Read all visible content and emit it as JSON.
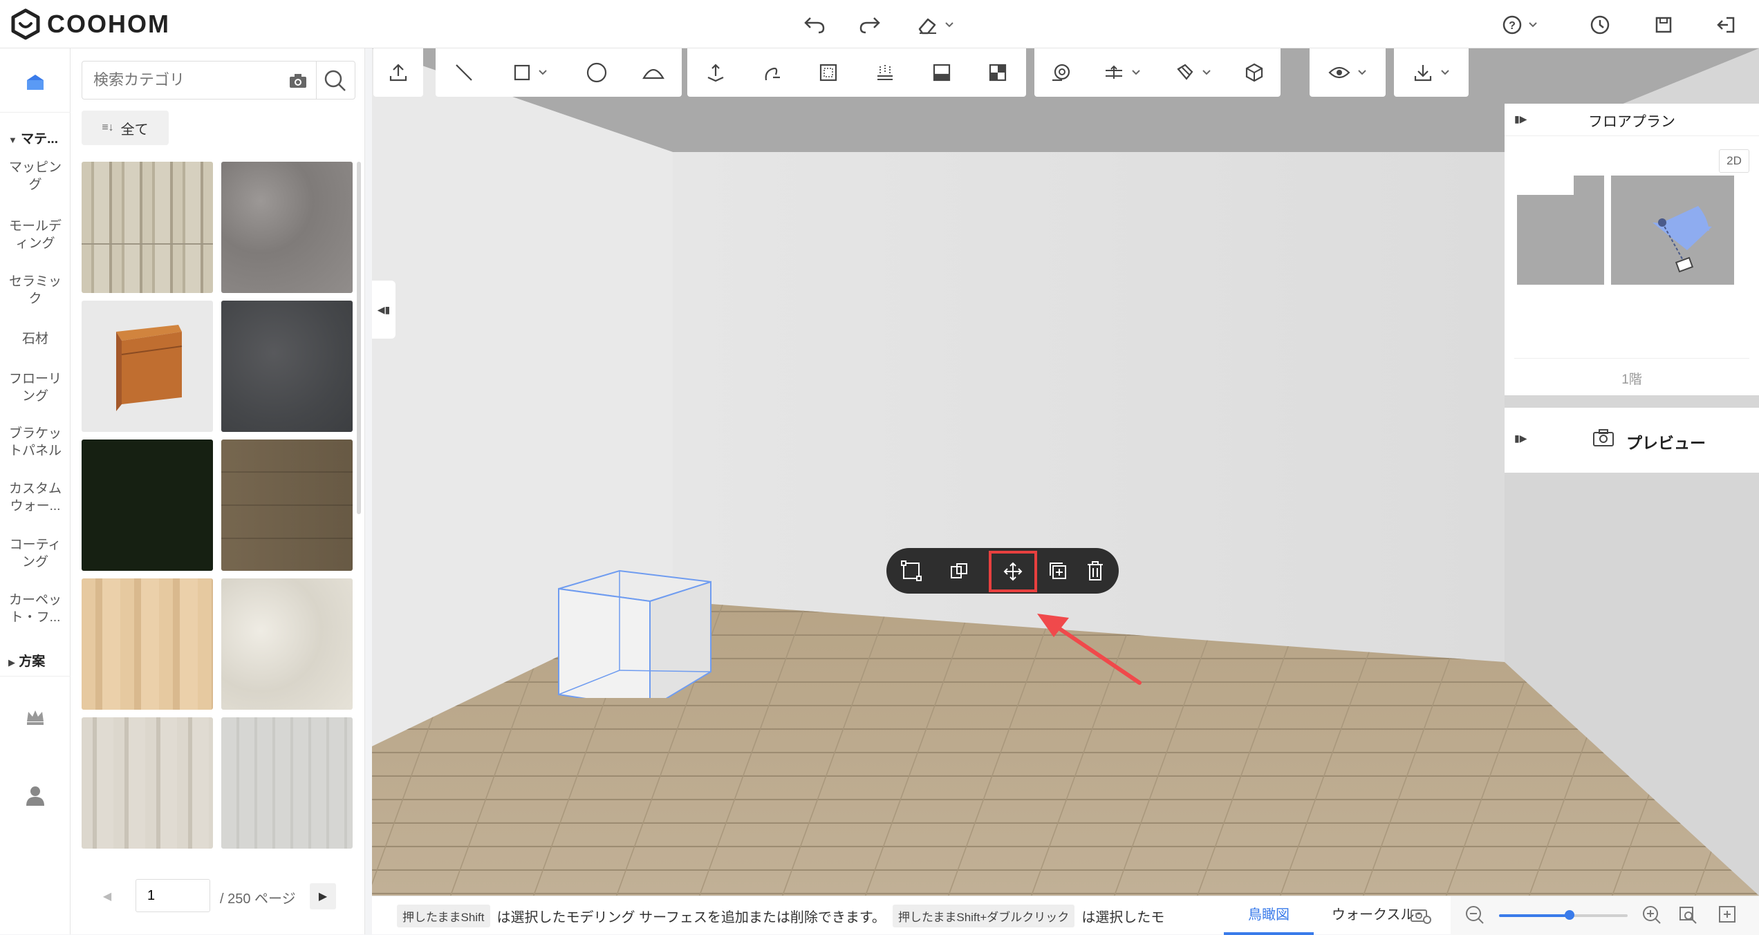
{
  "app": {
    "brand": "COOHOM"
  },
  "header": {
    "icons": [
      "undo-icon",
      "redo-icon",
      "eraser-icon",
      "help-icon",
      "history-icon",
      "save-icon",
      "exit-icon"
    ]
  },
  "leftrail": {
    "section_materials": "マテ...",
    "items": [
      "マッピング",
      "モールディング",
      "セラミック",
      "石材",
      "フローリング",
      "ブラケットパネル",
      "カスタムウォー...",
      "コーティング",
      "カーペット・フ..."
    ],
    "section_plan": "方案"
  },
  "catalog": {
    "search_placeholder": "検索カテゴリ",
    "all_label": "全て",
    "tiles": [
      {
        "kind": "wood-light",
        "color": "#c9c1ad"
      },
      {
        "kind": "carpet-gray",
        "color": "#8f8b89"
      },
      {
        "kind": "molding",
        "color": "#eaeaea"
      },
      {
        "kind": "stone-dark",
        "color": "#4a4c4f"
      },
      {
        "kind": "dark-green",
        "color": "#152012"
      },
      {
        "kind": "wood-gray",
        "color": "#a59a88"
      },
      {
        "kind": "wood-blonde",
        "color": "#e2c49b"
      },
      {
        "kind": "marble-white",
        "color": "#e3e0d6"
      },
      {
        "kind": "wood-pale",
        "color": "#d9d4ca"
      },
      {
        "kind": "wood-silver",
        "color": "#d3d3d0"
      }
    ],
    "pager": {
      "page": "1",
      "total": "/ 250 ページ"
    }
  },
  "floorplan": {
    "title": "フロアプラン",
    "mode": "2D",
    "floor": "1階"
  },
  "preview": {
    "title": "プレビュー"
  },
  "status": {
    "kbd1": "押したままShift",
    "text1": "は選択したモデリング サーフェスを追加または削除できます。",
    "kbd2": "押したままShift+ダブルクリック",
    "text2": "は選択したモ",
    "tab_birdseye": "鳥瞰図",
    "tab_walkthrough": "ウォークスルー"
  },
  "zoom": {
    "level": 0.55
  },
  "colors": {
    "accent": "#3a7bea",
    "highlight": "#e8403f",
    "floor": "#b9a68c"
  }
}
